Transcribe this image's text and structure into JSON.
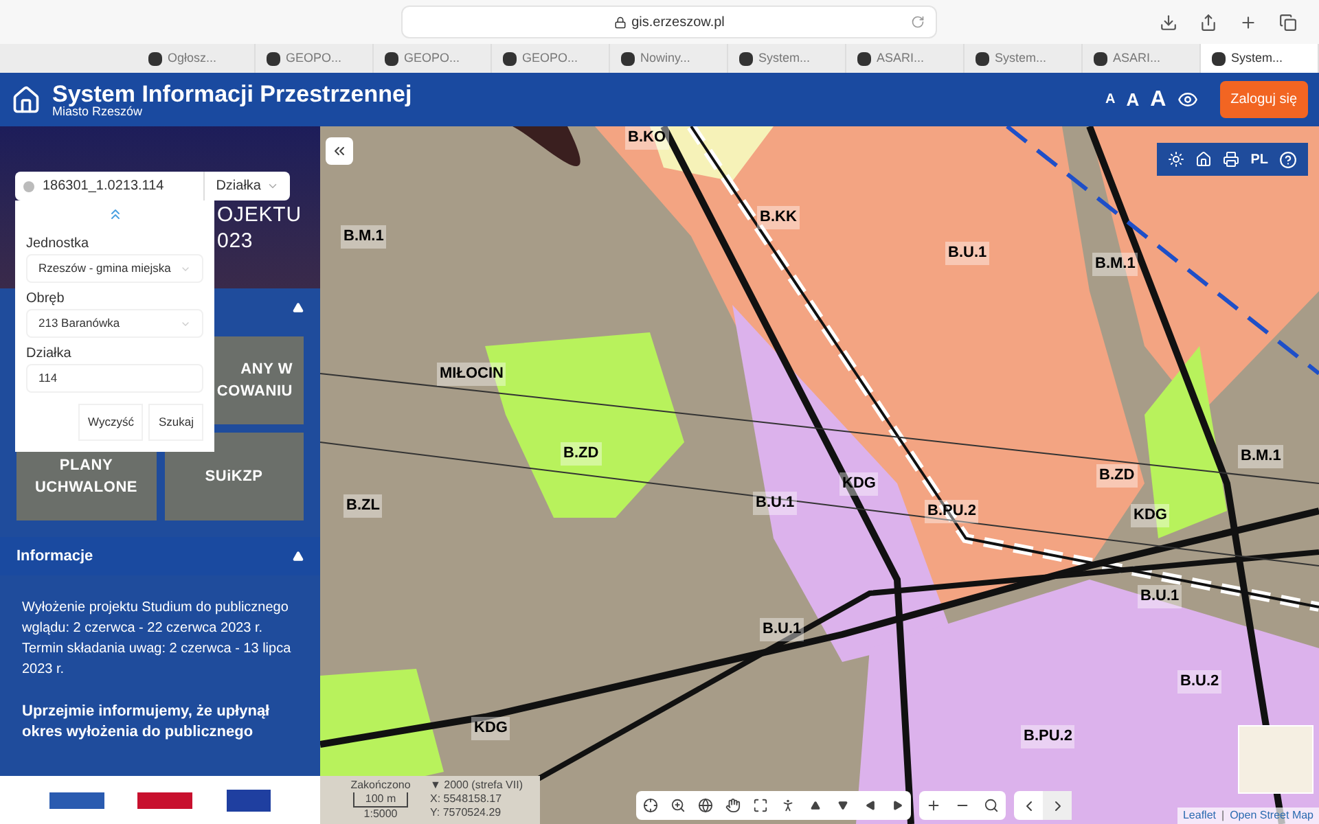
{
  "browser": {
    "address": "gis.erzeszow.pl",
    "tabs": [
      {
        "label": "Ogłosz...",
        "selected": false
      },
      {
        "label": "GEOPO...",
        "selected": false
      },
      {
        "label": "GEOPO...",
        "selected": false
      },
      {
        "label": "GEOPO...",
        "selected": false
      },
      {
        "label": "Nowiny...",
        "selected": false
      },
      {
        "label": "System...",
        "selected": false
      },
      {
        "label": "ASARI...",
        "selected": false
      },
      {
        "label": "System...",
        "selected": false
      },
      {
        "label": "ASARI...",
        "selected": false
      },
      {
        "label": "System...",
        "selected": true
      }
    ]
  },
  "header": {
    "title": "System Informacji Przestrzennej",
    "subtitle": "Miasto Rzeszów",
    "font_sizes": [
      "A",
      "A",
      "A"
    ],
    "login": "Zaloguj się"
  },
  "sidebar": {
    "hero_lines": [
      "OJEKTU",
      "023"
    ],
    "search": {
      "value": "186301_1.0213.114",
      "type": "Działka"
    },
    "popup": {
      "fields": [
        {
          "label": "Jednostka",
          "value": "Rzeszów - gmina miejska",
          "kind": "select"
        },
        {
          "label": "Obręb",
          "value": "213 Baranówka",
          "kind": "select"
        },
        {
          "label": "Działka",
          "value": "114",
          "kind": "input"
        }
      ],
      "buttons": [
        "Wyczyść",
        "Szukaj"
      ]
    },
    "tiles": [
      {
        "lines": [
          "ANY W",
          "COWANIU"
        ]
      },
      {
        "lines": [
          "PLANY",
          "UCHWALONE"
        ]
      },
      {
        "lines": [
          "SUiKZP"
        ]
      }
    ],
    "info": {
      "title": "Informacje",
      "expanded": true,
      "paragraphs": [
        "Wyłożenie projektu Studium do publicznego wglądu: 2 czerwca - 22 czerwca 2023 r. Termin składania uwag: 2 czerwca - 13 lipca 2023 r.",
        "**Uprzejmie informujemy, że upłynął okres wyłożenia do publicznego**"
      ]
    }
  },
  "map": {
    "labels": [
      "B.KO",
      "B.KK",
      "B.M.1",
      "B.U.1",
      "B.M.1",
      "MIŁOCIN",
      "B.ZD",
      "B.ZD",
      "B.M.1",
      "B.ZL",
      "B.U.1",
      "KDG",
      "B.PU.2",
      "KDG",
      "B.U.1",
      "B.U.1",
      "B.U.2",
      "KDG",
      "B.PU.2"
    ],
    "toolbar_lang": "PL",
    "status": {
      "state": "Zakończono",
      "scale_bar": "100 m",
      "scale": "1:5000",
      "crs": "▼ 2000 (strefa VII)",
      "x": "X: 5548158.17",
      "y": "Y: 7570524.29"
    },
    "attribution": [
      "Leaflet",
      "Open Street Map"
    ],
    "attribution_separator": "|"
  }
}
